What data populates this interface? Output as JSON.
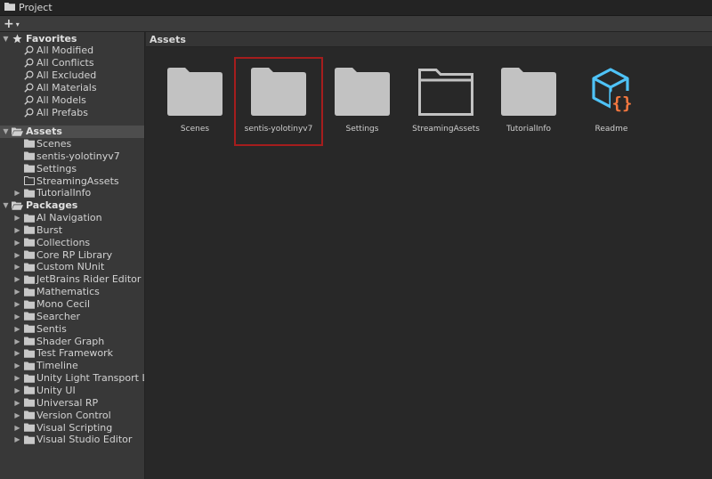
{
  "window": {
    "tab_title": "Project"
  },
  "toolbar": {
    "add_label": "+",
    "add_caret": "▾"
  },
  "favorites": {
    "label": "Favorites",
    "items": [
      "All Modified",
      "All Conflicts",
      "All Excluded",
      "All Materials",
      "All Models",
      "All Prefabs"
    ]
  },
  "assets_tree": {
    "label": "Assets",
    "items": [
      {
        "label": "Scenes",
        "icon": "folder-filled",
        "expandable": false
      },
      {
        "label": "sentis-yolotinyv7",
        "icon": "folder-filled",
        "expandable": false
      },
      {
        "label": "Settings",
        "icon": "folder-filled",
        "expandable": false
      },
      {
        "label": "StreamingAssets",
        "icon": "folder-outline",
        "expandable": false
      },
      {
        "label": "TutorialInfo",
        "icon": "folder-filled",
        "expandable": true
      }
    ]
  },
  "packages": {
    "label": "Packages",
    "items": [
      "AI Navigation",
      "Burst",
      "Collections",
      "Core RP Library",
      "Custom NUnit",
      "JetBrains Rider Editor",
      "Mathematics",
      "Mono Cecil",
      "Searcher",
      "Sentis",
      "Shader Graph",
      "Test Framework",
      "Timeline",
      "Unity Light Transport Lib",
      "Unity UI",
      "Universal RP",
      "Version Control",
      "Visual Scripting",
      "Visual Studio Editor"
    ]
  },
  "main": {
    "breadcrumb": "Assets",
    "tiles": [
      {
        "label": "Scenes",
        "icon": "folder-filled"
      },
      {
        "label": "sentis-yolotinyv7",
        "icon": "folder-filled",
        "highlighted": true
      },
      {
        "label": "Settings",
        "icon": "folder-filled"
      },
      {
        "label": "StreamingAssets",
        "icon": "folder-outline"
      },
      {
        "label": "TutorialInfo",
        "icon": "folder-filled"
      },
      {
        "label": "Readme",
        "icon": "readme-asset-icon"
      }
    ]
  },
  "colors": {
    "folder": "#c2c2c2",
    "highlight": "#a51d1d",
    "readme_cube": "#4fc3f7",
    "readme_braces": "#f4773f"
  }
}
